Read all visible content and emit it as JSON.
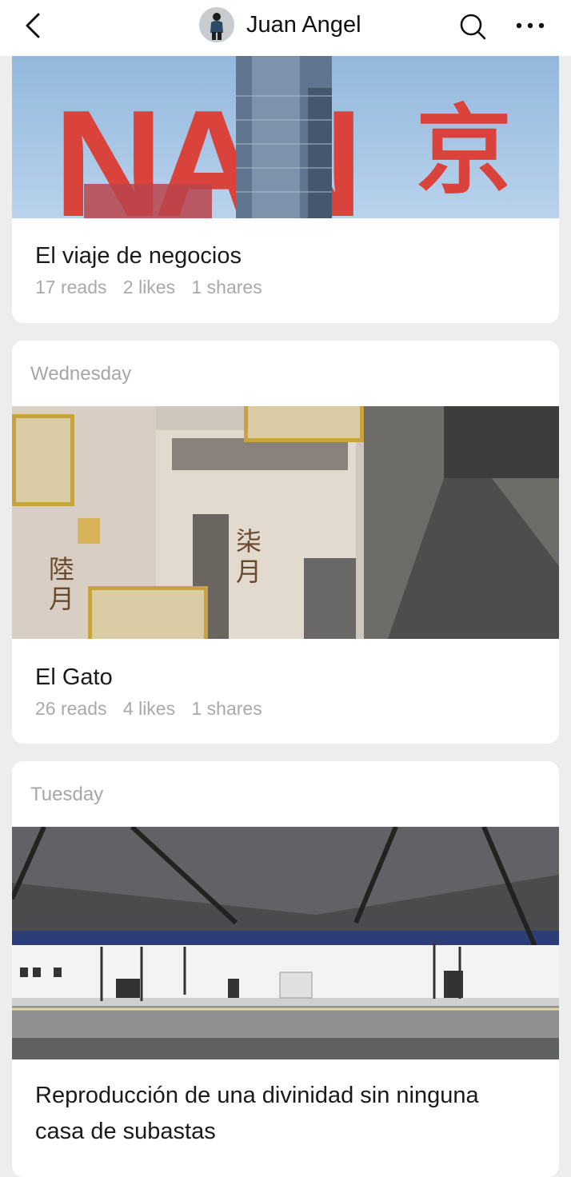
{
  "header": {
    "author_name": "Juan Angel"
  },
  "articles": [
    {
      "day": "",
      "title": "El viaje de negocios",
      "reads": "17 reads",
      "likes": "2 likes",
      "shares": "1 shares"
    },
    {
      "day": "Wednesday",
      "title": "El Gato",
      "reads": "26 reads",
      "likes": "4 likes",
      "shares": "1 shares",
      "image_text": [
        "陸",
        "月",
        "柒",
        "月"
      ]
    },
    {
      "day": "Tuesday",
      "title": "Reproducción de una divinidad sin ninguna casa de subastas",
      "reads": "",
      "likes": "",
      "shares": ""
    }
  ],
  "banner_text": {
    "latin": "NAN",
    "chinese": "京"
  },
  "colors": {
    "background": "#ededed",
    "card": "#ffffff",
    "muted_text": "#a9a9a9",
    "banner_red": "#d9433b"
  }
}
